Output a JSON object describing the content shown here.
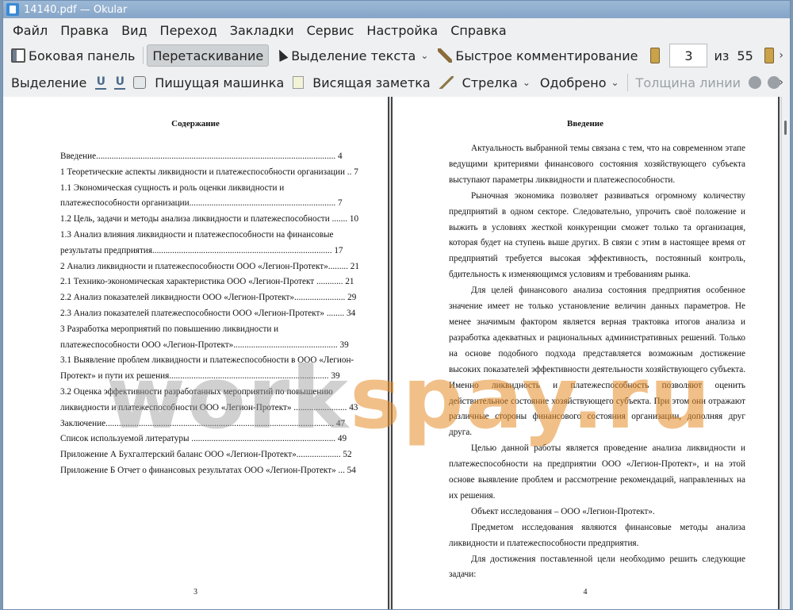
{
  "window": {
    "title": "14140.pdf — Okular"
  },
  "menu": [
    "Файл",
    "Правка",
    "Вид",
    "Переход",
    "Закладки",
    "Сервис",
    "Настройка",
    "Справка"
  ],
  "toolbar1": {
    "sidebar": "Боковая панель",
    "drag": "Перетаскивание",
    "text_select": "Выделение текста",
    "quick_comment": "Быстрое комментирование",
    "page_current": "3",
    "page_of": "из",
    "page_total": "55"
  },
  "toolbar2": {
    "selection": "Выделение",
    "typewriter": "Пишущая машинка",
    "hanging_note": "Висящая заметка",
    "arrow": "Стрелка",
    "approved": "Одобрено",
    "line_width": "Толщина линии"
  },
  "left_page": {
    "title": "Содержание",
    "toc": [
      "Введение............................................................................................................ 4",
      "1 Теоретические аспекты ликвидности и платежеспособности организации .. 7",
      "1.1   Экономическая   сущность   и   роль   оценки   ликвидности   и",
      "платежеспособности организации.................................................................. 7",
      "1.2  Цель, задачи и методы анализа ликвидности и платежеспособности ....... 10",
      "1.3  Анализ  влияния  ликвидности  и  платежеспособности  на  финансовые",
      "результаты предприятия................................................................................. 17",
      "2 Анализ ликвидности и платежеспособности ООО «Легион-Протект»......... 21",
      "2.1 Технико-экономическая характеристика ООО «Легион-Протект ............ 21",
      "2.2 Анализ показателей ликвидности ООО «Легион-Протект»....................... 29",
      "2.3 Анализ показателей платежеспособности ООО «Легион-Протект» ........ 34",
      "3     Разработка     мероприятий     по     повышению     ликвидности     и",
      "платежеспособности ООО «Легион-Протект»............................................... 39",
      "3.1  Выявление проблем ликвидности и платежеспособности в ООО «Легион-",
      "Протект»    и пути их решения........................................................................ 39",
      "3.2  Оценка  эффективности  разработанных  мероприятий  по  повышению",
      "ликвидности и платежеспособности ООО «Легион-Протект» ........................ 43",
      "Заключение....................................................................................................... 47",
      "Список используемой литературы ................................................................. 49",
      "Приложение А Бухгалтерский баланс ООО «Легион-Протект».................... 52",
      "Приложение Б Отчет о финансовых результатах ООО «Легион-Протект» ... 54"
    ],
    "page_number": "3"
  },
  "right_page": {
    "title": "Введение",
    "paragraphs": [
      "Актуальность выбранной темы связана с тем, что на современном этапе ведущими критериями финансового состояния хозяйствующего субъекта выступают параметры ликвидности и платежеспособности.",
      "Рыночная экономика позволяет развиваться огромному количеству предприятий в одном секторе. Следовательно, упрочить своё положение и выжить в условиях жесткой конкуренции сможет только та организация, которая будет на ступень выше других. В связи с этим в настоящее время от предприятий требуется высокая эффективность, постоянный контроль, бдительность к изменяющимся условиям и требованиям рынка.",
      "Для целей финансового анализа состояния предприятия особенное значение имеет не только установление величин данных параметров. Не менее значимым фактором является верная трактовка итогов анализа и разработка адекватных и рациональных административных решений. Только на основе подобного подхода представляется возможным достижение высоких показателей эффективности деятельности хозяйствующего субъекта. Именно ликвидность и  платежеспособность позволяют оценить действительное состояние хозяйствующего субъекта. При этом они отражают различные стороны финансового состояния организации, дополняя друг друга.",
      "Целью данной работы является проведение анализа ликвидности и платежеспособности на предприятии ООО «Легион-Протект», и на этой основе выявление проблем и рассмотрение рекомендаций, направленных на их решения.",
      "Объект исследования – ООО «Легион-Протект».",
      "Предметом исследования являются финансовые методы анализа ликвидности и платежеспособности  предприятия.",
      "Для достижения поставленной цели необходимо решить следующие задачи:"
    ],
    "page_number": "4"
  },
  "watermark": {
    "part_a": "work",
    "part_b": "spay.ru"
  },
  "colors": {
    "accent": "#86a5c7",
    "watermark_orange": "#e68c28"
  }
}
